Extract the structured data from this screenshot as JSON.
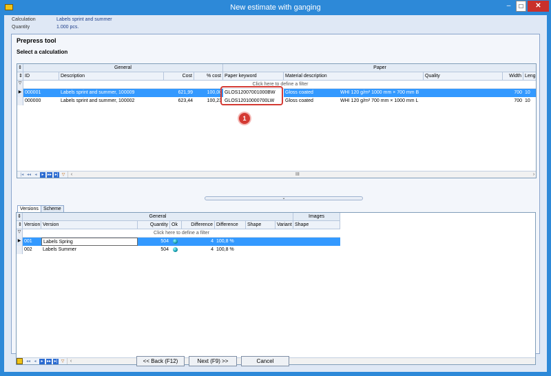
{
  "window": {
    "title": "New estimate with ganging",
    "minimize": "–",
    "maximize": "□",
    "close": "✕"
  },
  "info": {
    "calc_label": "Calculation",
    "calc_value": "Labels sprint and summer",
    "qty_label": "Quantity",
    "qty_value": "1.000 pcs."
  },
  "panel": {
    "title": "Prepress tool",
    "subtitle": "Select a calculation"
  },
  "top_grid": {
    "group_general": "General",
    "group_paper": "Paper",
    "columns": [
      "ID",
      "Description",
      "Cost",
      "% cost",
      "Paper keyword",
      "Material description",
      "Quality",
      "Width",
      "Leng"
    ],
    "filter": "Click here to define a filter",
    "rows": [
      {
        "id": "000001",
        "description": "Labels sprint and summer, 100009",
        "cost": "621,99",
        "pct_cost": "100,00",
        "paper_keyword": "GLOS12007001000BW",
        "material": "Gloss coated",
        "quality": "WHI 120 g/m² 1000 mm × 700 mm B",
        "width": "700",
        "length": "10"
      },
      {
        "id": "000000",
        "description": "Labels sprint and summer, 100002",
        "cost": "623,44",
        "pct_cost": "100,23",
        "paper_keyword": "GLOS12010000700LW",
        "material": "Gloss coated",
        "quality": "WHI 120 g/m² 700 mm × 1000 mm L",
        "width": "700",
        "length": "10"
      }
    ],
    "scroll_grip": "III"
  },
  "callout": {
    "number": "1"
  },
  "splitter_glyph": "⌄",
  "tabs": [
    "Versions",
    "Scheme"
  ],
  "bottom_grid": {
    "group_general": "General",
    "group_images": "Images",
    "columns": [
      "Version",
      "Version",
      "Quantity",
      "Ok",
      "Difference",
      "Difference",
      "Shape",
      "Variant",
      "Shape"
    ],
    "filter": "Click here to define a filter",
    "rows": [
      {
        "code": "001",
        "name": "Labels Spring",
        "quantity": "504",
        "difference": "4",
        "difference_pct": "100,8 %"
      },
      {
        "code": "002",
        "name": "Labels Summer",
        "quantity": "504",
        "difference": "4",
        "difference_pct": "100,8 %"
      }
    ]
  },
  "nav_glyphs": {
    "first": "|◂",
    "prev_page": "◂◂",
    "prev": "◂",
    "next": "▸",
    "next_page": "▸▸",
    "last": "▸|",
    "filter": "▽",
    "left": "‹",
    "right": "›",
    "gutter": "⇕",
    "filter_icon": "▽",
    "row_arrow": "▶"
  },
  "buttons": {
    "back": "<< Back (F12)",
    "next": "Next (F9) >>",
    "cancel": "Cancel"
  },
  "colors": {
    "title_bar": "#2d89d8",
    "selection": "#3399ff",
    "callout": "#d43a33"
  }
}
